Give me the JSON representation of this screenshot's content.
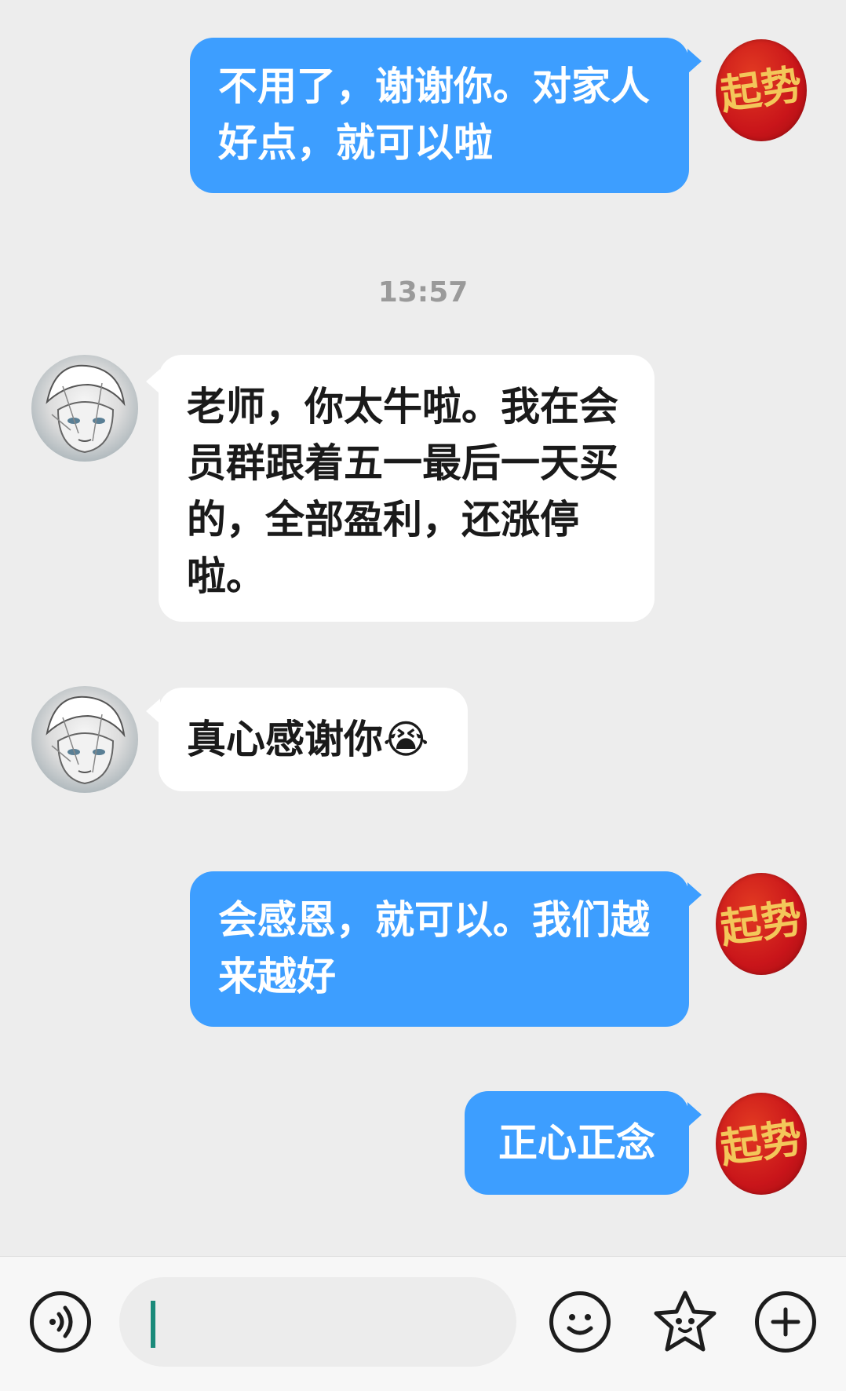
{
  "messages": [
    {
      "from": "me",
      "text": "不用了，谢谢你。对家人好点，就可以啦",
      "avatar_text": "起势"
    },
    {
      "type": "timestamp",
      "text": "13:57"
    },
    {
      "from": "other",
      "text": "老师，你太牛啦。我在会员群跟着五一最后一天买的，全部盈利，还涨停啦。"
    },
    {
      "from": "other",
      "text": "真心感谢你",
      "emoji": "😭"
    },
    {
      "from": "me",
      "text": "会感恩，就可以。我们越来越好",
      "avatar_text": "起势"
    },
    {
      "from": "me",
      "text": "正心正念",
      "avatar_text": "起势"
    }
  ],
  "bottom_bar": {
    "icons": [
      "voice-icon",
      "emoji-icon",
      "sticker-icon",
      "plus-icon"
    ],
    "input_value": ""
  },
  "colors": {
    "outgoing_bubble": "#3d9eff",
    "incoming_bubble": "#ffffff",
    "background": "#ededed",
    "avatar_red": "#c9151a",
    "avatar_gold": "#f3c75a"
  }
}
